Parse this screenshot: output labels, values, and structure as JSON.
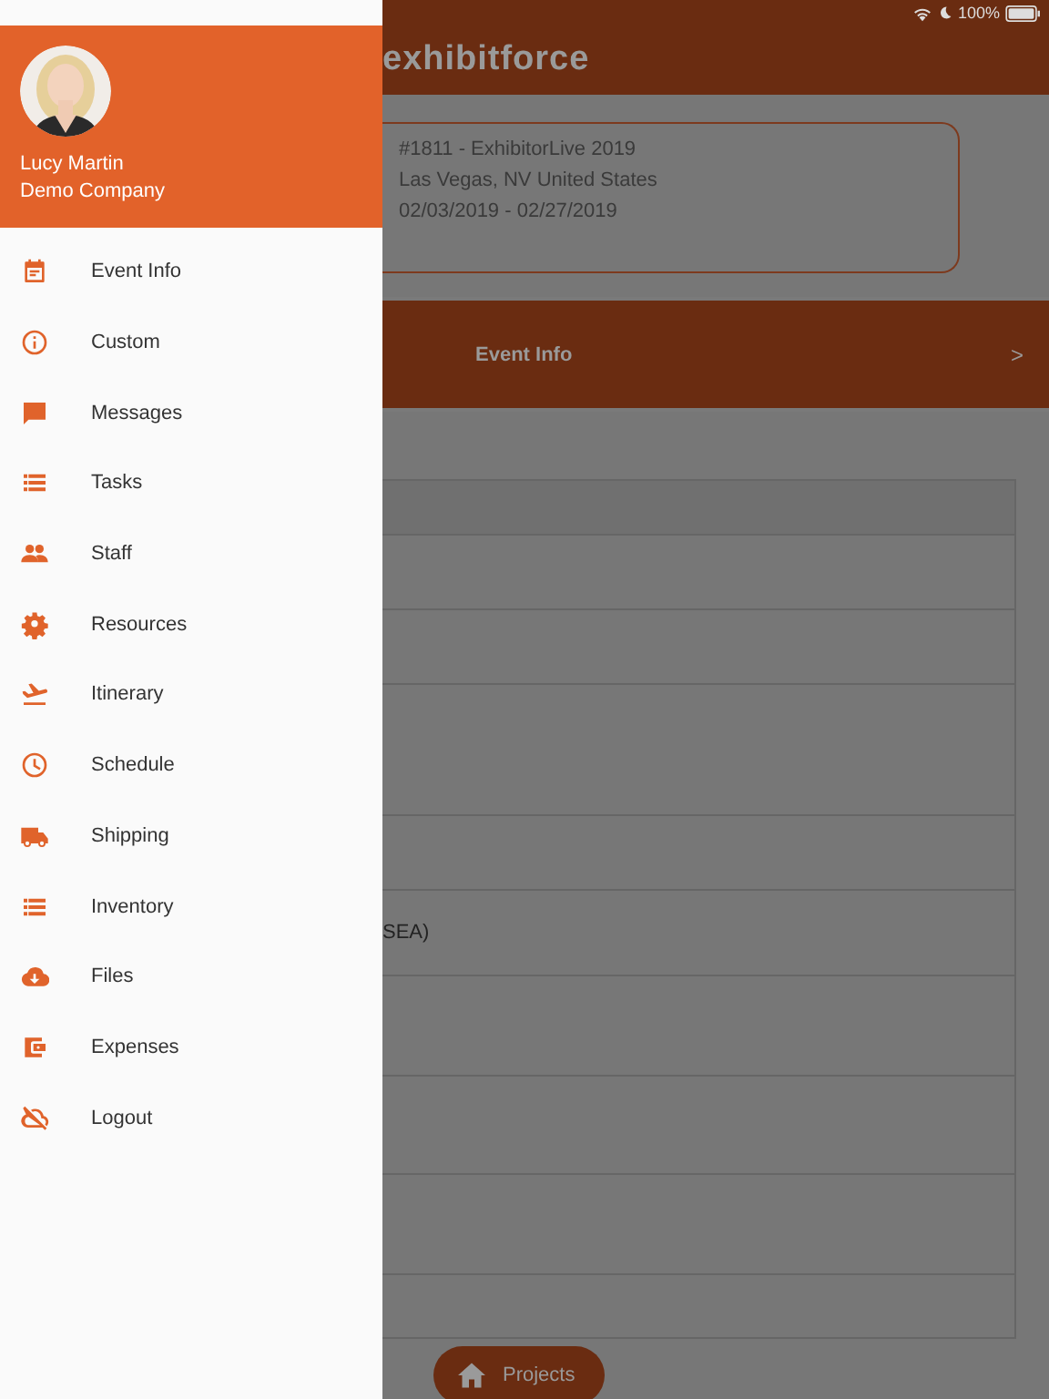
{
  "status_bar": {
    "battery": "100%"
  },
  "app_bar": {
    "logo": "exhibitforce"
  },
  "event_card": {
    "lines": [
      "#1811 - ExhibitorLive 2019",
      "Las Vegas, NV United States",
      "02/03/2019 - 02/27/2019"
    ]
  },
  "section_bar": {
    "title": "Event Info",
    "chevron": ">"
  },
  "table": {
    "partial_cell": "SEA)"
  },
  "bottom_nav": {
    "button": "Projects"
  },
  "drawer": {
    "user": {
      "name": "Lucy Martin",
      "company": "Demo Company"
    },
    "items": [
      {
        "label": "Event Info"
      },
      {
        "label": "Custom"
      },
      {
        "label": "Messages"
      },
      {
        "label": "Tasks"
      },
      {
        "label": "Staff"
      },
      {
        "label": "Resources"
      },
      {
        "label": "Itinerary"
      },
      {
        "label": "Schedule"
      },
      {
        "label": "Shipping"
      },
      {
        "label": "Inventory"
      },
      {
        "label": "Files"
      },
      {
        "label": "Expenses"
      },
      {
        "label": "Logout"
      }
    ]
  }
}
